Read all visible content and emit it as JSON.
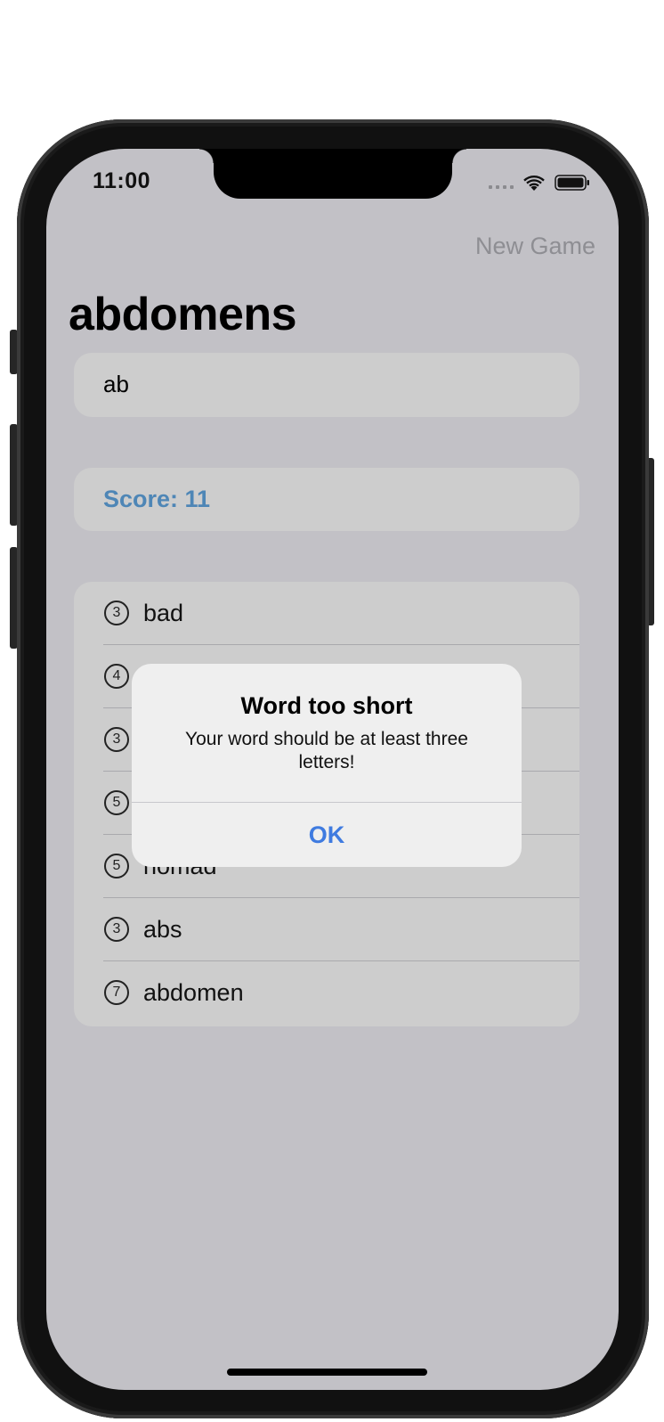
{
  "status_bar": {
    "time": "11:00",
    "icons": [
      "cellular-signal-icon",
      "wifi-icon",
      "battery-icon"
    ]
  },
  "nav": {
    "new_game_label": "New Game",
    "title": "abdomens"
  },
  "input": {
    "value": "ab"
  },
  "score": {
    "label": "Score: 11"
  },
  "words": [
    {
      "count": "3",
      "word": "bad"
    },
    {
      "count": "4",
      "word": ""
    },
    {
      "count": "3",
      "word": ""
    },
    {
      "count": "5",
      "word": ""
    },
    {
      "count": "5",
      "word": "nomad"
    },
    {
      "count": "3",
      "word": "abs"
    },
    {
      "count": "7",
      "word": "abdomen"
    }
  ],
  "alert": {
    "title": "Word too short",
    "message": "Your word should be at least three letters!",
    "ok_label": "OK"
  },
  "colors": {
    "screen_background": "#c2c1c6",
    "card_background": "#cdcdcd",
    "score_color": "#4e86b6",
    "alert_button_color": "#3f7be0",
    "new_game_color": "#8e8e93"
  }
}
